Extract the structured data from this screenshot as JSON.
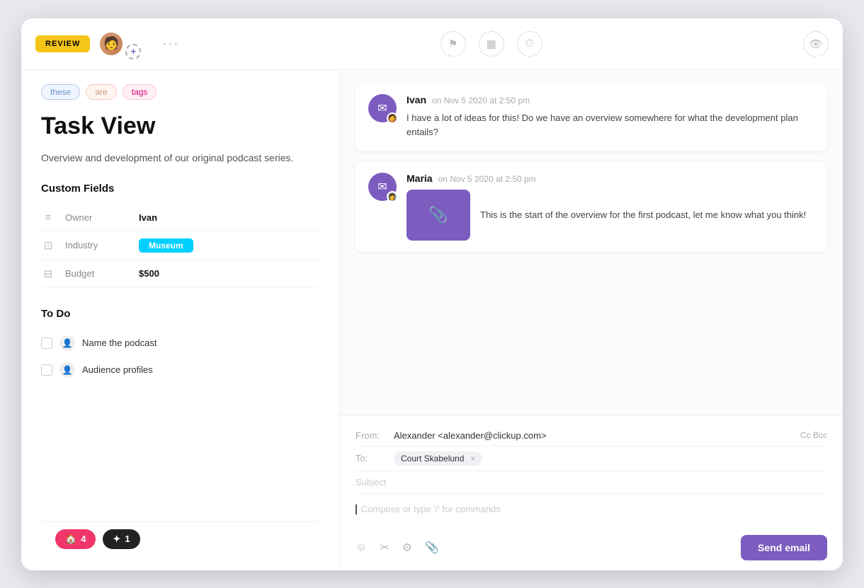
{
  "topbar": {
    "review_label": "REVIEW",
    "more_dots": "···",
    "icons": [
      "flag",
      "calendar",
      "clock"
    ],
    "eye_icon": "👁"
  },
  "tags": [
    {
      "label": "these",
      "class": "tag-these"
    },
    {
      "label": "are",
      "class": "tag-are"
    },
    {
      "label": "tags",
      "class": "tag-tags"
    }
  ],
  "task": {
    "title": "Task View",
    "description": "Overview and development of our original podcast series."
  },
  "custom_fields": {
    "section_title": "Custom Fields",
    "fields": [
      {
        "icon": "≡",
        "label": "Owner",
        "value": "Ivan",
        "type": "text"
      },
      {
        "icon": "⊡",
        "label": "Industry",
        "value": "Museum",
        "type": "badge"
      },
      {
        "icon": "⊟",
        "label": "Budget",
        "value": "$500",
        "type": "text"
      }
    ]
  },
  "todo": {
    "section_title": "To Do",
    "items": [
      {
        "text": "Name the podcast"
      },
      {
        "text": "Audience profiles"
      }
    ]
  },
  "badges": [
    {
      "icon": "🏠",
      "count": "4",
      "class": "badge-pink"
    },
    {
      "icon": "✦",
      "count": "1",
      "class": "badge-dark"
    }
  ],
  "comments": [
    {
      "author": "Ivan",
      "time": "on Nov 5 2020 at 2:50 pm",
      "text": "I have a lot of ideas for this! Do we have an overview somewhere for what the development plan entails?",
      "has_attachment": false
    },
    {
      "author": "Maria",
      "time": "on Nov 5 2020 at 2:50 pm",
      "text": "This is the start of the overview for the first podcast, let me know what you think!",
      "has_attachment": true
    }
  ],
  "email": {
    "from_label": "From:",
    "from_value": "Alexander <alexander@clickup.com>",
    "cc_bcc": "Cc  Bcc",
    "to_label": "To:",
    "to_chip": "Court Skabelund",
    "subject_placeholder": "Subject",
    "compose_placeholder": "Compose or type '/' for commands",
    "send_label": "Send email"
  }
}
